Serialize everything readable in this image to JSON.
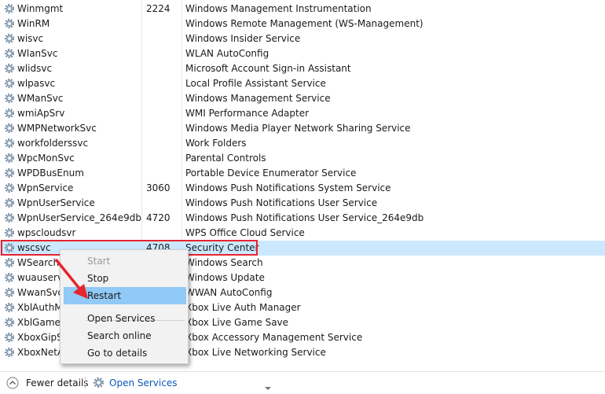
{
  "services": [
    {
      "name": "Winmgmt",
      "pid": "2224",
      "description": "Windows Management Instrumentation"
    },
    {
      "name": "WinRM",
      "pid": "",
      "description": "Windows Remote Management (WS-Management)"
    },
    {
      "name": "wisvc",
      "pid": "",
      "description": "Windows Insider Service"
    },
    {
      "name": "WlanSvc",
      "pid": "",
      "description": "WLAN AutoConfig"
    },
    {
      "name": "wlidsvc",
      "pid": "",
      "description": "Microsoft Account Sign-in Assistant"
    },
    {
      "name": "wlpasvc",
      "pid": "",
      "description": "Local Profile Assistant Service"
    },
    {
      "name": "WManSvc",
      "pid": "",
      "description": "Windows Management Service"
    },
    {
      "name": "wmiApSrv",
      "pid": "",
      "description": "WMI Performance Adapter"
    },
    {
      "name": "WMPNetworkSvc",
      "pid": "",
      "description": "Windows Media Player Network Sharing Service"
    },
    {
      "name": "workfolderssvc",
      "pid": "",
      "description": "Work Folders"
    },
    {
      "name": "WpcMonSvc",
      "pid": "",
      "description": "Parental Controls"
    },
    {
      "name": "WPDBusEnum",
      "pid": "",
      "description": "Portable Device Enumerator Service"
    },
    {
      "name": "WpnService",
      "pid": "3060",
      "description": "Windows Push Notifications System Service"
    },
    {
      "name": "WpnUserService",
      "pid": "",
      "description": "Windows Push Notifications User Service"
    },
    {
      "name": "WpnUserService_264e9db",
      "pid": "4720",
      "description": "Windows Push Notifications User Service_264e9db"
    },
    {
      "name": "wpscloudsvr",
      "pid": "",
      "description": "WPS Office Cloud Service"
    },
    {
      "name": "wscsvc",
      "pid": "4708",
      "description": "Security Center",
      "selected": true
    },
    {
      "name": "WSearch",
      "pid": "",
      "description": "Windows Search"
    },
    {
      "name": "wuauserv",
      "pid": "",
      "description": "Windows Update"
    },
    {
      "name": "WwanSvc",
      "pid": "",
      "description": "WWAN AutoConfig"
    },
    {
      "name": "XblAuthM",
      "pid": "",
      "description": "Xbox Live Auth Manager"
    },
    {
      "name": "XblGameS",
      "pid": "",
      "description": "Xbox Live Game Save"
    },
    {
      "name": "XboxGipSv",
      "pid": "",
      "description": "Xbox Accessory Management Service"
    },
    {
      "name": "XboxNetA",
      "pid": "",
      "description": "Xbox Live Networking Service"
    }
  ],
  "context_menu": {
    "items": [
      {
        "label": "Start",
        "disabled": true
      },
      {
        "label": "Stop"
      },
      {
        "label": "Restart",
        "hover": true
      },
      {
        "label": "Open Services"
      },
      {
        "label": "Search online"
      },
      {
        "label": "Go to details"
      }
    ]
  },
  "bottom_bar": {
    "fewer_details_label": "Fewer details",
    "open_services_label": "Open Services"
  },
  "colors": {
    "selection": "#cce8ff",
    "menu_hover": "#91c9f7",
    "annotation_red": "#e8242c",
    "link_blue": "#0a59b8"
  },
  "icons": {
    "service": "gear-icon",
    "fewer_details": "chevron-up-icon",
    "open_services": "services-gear-icon"
  }
}
